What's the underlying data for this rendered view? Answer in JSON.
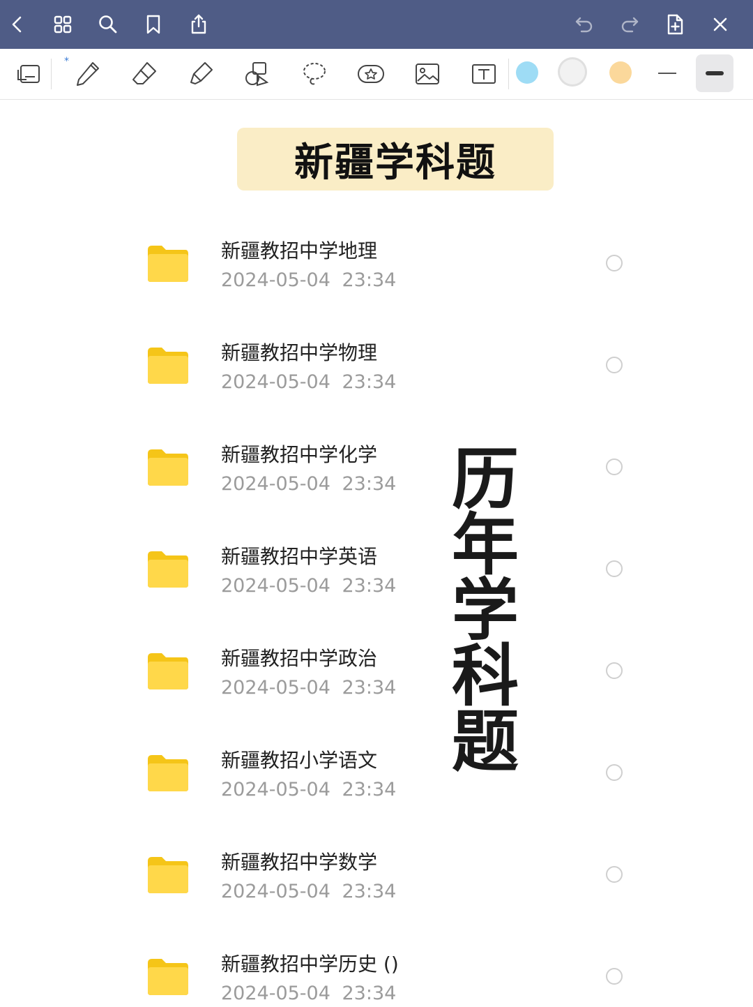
{
  "topbar": {
    "left_icons": [
      "back-icon",
      "grid-icon",
      "search-icon",
      "bookmark-icon",
      "share-icon"
    ],
    "right_icons": [
      "undo-icon",
      "redo-icon",
      "add-page-icon",
      "close-icon"
    ]
  },
  "toolbar": {
    "tools": [
      "page-layout-icon",
      "pen-icon",
      "eraser-icon",
      "highlighter-icon",
      "shapes-icon",
      "lasso-icon",
      "sticker-icon",
      "image-icon",
      "text-box-icon"
    ],
    "bluetooth_mark": "*",
    "colors": [
      "#9edcf5",
      "#f0f0f0",
      "#fbd89b"
    ],
    "strokes": [
      "thin-stroke",
      "thick-stroke"
    ]
  },
  "banner": {
    "title": "新疆学科题"
  },
  "files": [
    {
      "name": "新疆教招中学地理",
      "date": "2024-05-04  23:34"
    },
    {
      "name": "新疆教招中学物理",
      "date": "2024-05-04  23:34"
    },
    {
      "name": "新疆教招中学化学",
      "date": "2024-05-04  23:34"
    },
    {
      "name": "新疆教招中学英语",
      "date": "2024-05-04  23:34"
    },
    {
      "name": "新疆教招中学政治",
      "date": "2024-05-04  23:34"
    },
    {
      "name": "新疆教招小学语文",
      "date": "2024-05-04  23:34"
    },
    {
      "name": "新疆教招中学数学",
      "date": "2024-05-04  23:34"
    },
    {
      "name": "新疆教招中学历史 ()",
      "date": "2024-05-04  23:34"
    }
  ],
  "overlay": {
    "chars": [
      "历",
      "年",
      "学",
      "科",
      "题"
    ]
  }
}
